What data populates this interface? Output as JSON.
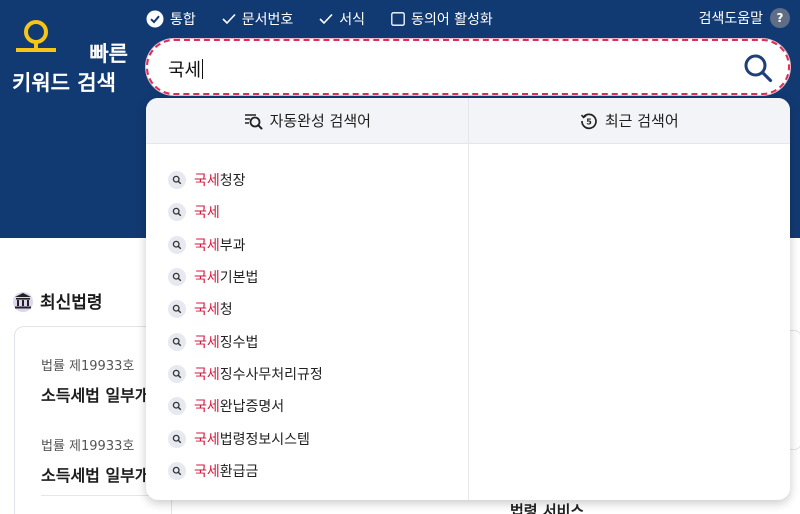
{
  "logo": {
    "line1": "빠른",
    "line2": "키워드 검색"
  },
  "options": [
    {
      "label": "통합",
      "checked": true
    },
    {
      "label": "문서번호",
      "checked": true
    },
    {
      "label": "서식",
      "checked": true
    },
    {
      "label": "동의어 활성화",
      "checked": false
    }
  ],
  "help": {
    "label": "검색도움말",
    "badge": "?"
  },
  "search": {
    "value": "국세"
  },
  "dropdown": {
    "tab_autocomplete": "자동완성 검색어",
    "tab_recent": "최근 검색어",
    "suggestions": [
      {
        "match": "국세",
        "rest": "청장"
      },
      {
        "match": "국세",
        "rest": ""
      },
      {
        "match": "국세",
        "rest": "부과"
      },
      {
        "match": "국세",
        "rest": "기본법"
      },
      {
        "match": "국세",
        "rest": "청"
      },
      {
        "match": "국세",
        "rest": "징수법"
      },
      {
        "match": "국세",
        "rest": "징수사무처리규정"
      },
      {
        "match": "국세",
        "rest": "완납증명서"
      },
      {
        "match": "국세",
        "rest": "법령정보시스템"
      },
      {
        "match": "국세",
        "rest": "환급금"
      }
    ]
  },
  "latest": {
    "title": "최신법령",
    "items": [
      {
        "no": "법률 제19933호",
        "title": "소득세법 일부개"
      },
      {
        "no": "법률 제19933호",
        "title": "소득세법 일부개"
      }
    ]
  },
  "bottom_peek": "법령 서비스",
  "colors": {
    "header": "#123a72",
    "highlight": "#d3173d",
    "accent_yellow": "#f5c518"
  }
}
